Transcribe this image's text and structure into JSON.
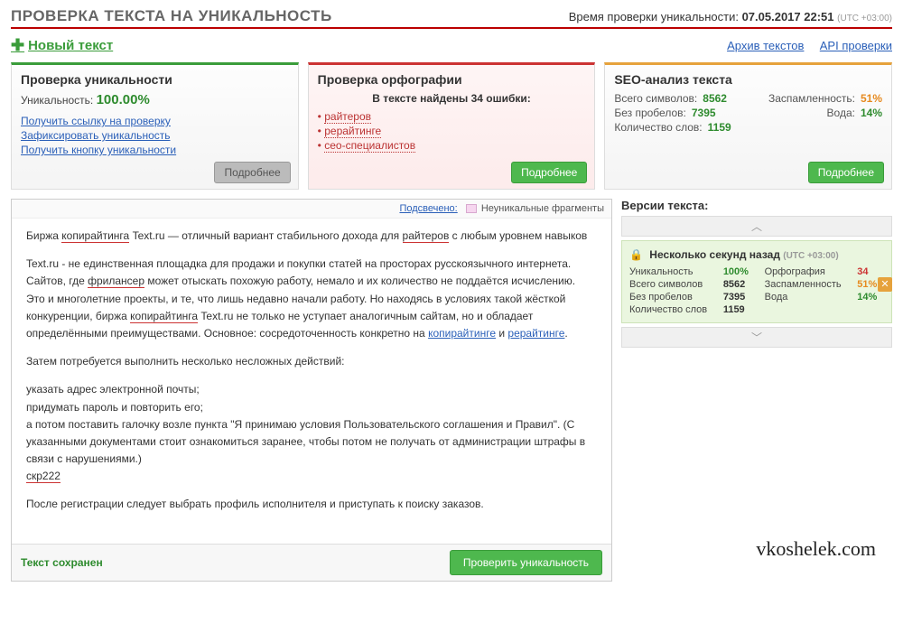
{
  "header": {
    "title": "ПРОВЕРКА ТЕКСТА НА УНИКАЛЬНОСТЬ",
    "time_label": "Время проверки уникальности:",
    "time_value": "07.05.2017 22:51",
    "tz": "(UTC +03:00)"
  },
  "subheader": {
    "new_text": "Новый текст",
    "archive": "Архив текстов",
    "api": "API проверки"
  },
  "uniq_panel": {
    "title": "Проверка уникальности",
    "label": "Уникальность:",
    "value": "100.00%",
    "link1": "Получить ссылку на проверку",
    "link2": "Зафиксировать уникальность",
    "link3": "Получить кнопку уникальности",
    "more": "Подробнее"
  },
  "spell_panel": {
    "title": "Проверка орфографии",
    "found": "В тексте найдены 34 ошибки:",
    "e1": "райтеров",
    "e2": "рерайтинге",
    "e3": "сео-специалистов",
    "more": "Подробнее"
  },
  "seo_panel": {
    "title": "SEO-анализ текста",
    "sym_label": "Всего символов:",
    "sym_val": "8562",
    "spam_label": "Заспамленность:",
    "spam_val": "51%",
    "nosp_label": "Без пробелов:",
    "nosp_val": "7395",
    "water_label": "Вода:",
    "water_val": "14%",
    "words_label": "Количество слов:",
    "words_val": "1159",
    "more": "Подробнее"
  },
  "legend": {
    "highlighted": "Подсвечено:",
    "nonunique": "Неуникальные фрагменты"
  },
  "text": {
    "p1a": "Биржа ",
    "p1b": "копирайтинга",
    "p1c": " Text.ru — отличный вариант стабильного дохода для ",
    "p1d": "райтеров",
    "p1e": " с любым уровнем навыков",
    "p2a": "Text.ru - не единственная площадка для продажи и покупки статей на просторах русскоязычного интернета. Сайтов, где ",
    "p2b": "фрилансер",
    "p2c": " может отыскать похожую работу, немало и их количество не поддаётся исчислению. Это и многолетние проекты, и те, что лишь недавно начали работу. Но находясь в условиях такой жёсткой конкуренции, биржа ",
    "p2d": "копирайтинга",
    "p2e": " Text.ru не только не уступает аналогичным сайтам, но и обладает определёнными преимуществами. Основное: сосредоточенность конкретно на ",
    "p2f": "копирайтинге",
    "p2g": " и ",
    "p2h": "рерайтинге",
    "p2i": ".",
    "p3": "Затем потребуется выполнить несколько несложных действий:",
    "p4": "указать адрес электронной почты;",
    "p5": "придумать пароль и повторить его;",
    "p6": "а потом поставить галочку возле пункта \"Я принимаю условия Пользовательского соглашения и Правил\". (С указанными документами стоит ознакомиться заранее, чтобы потом не получать от администрации штрафы в связи с нарушениями.)",
    "p7": "скр222",
    "p8": "После регистрации следует выбрать профиль исполнителя и приступать к поиску заказов."
  },
  "footer": {
    "saved": "Текст сохранен",
    "check": "Проверить уникальность"
  },
  "versions": {
    "title": "Версии текста:",
    "head": "Несколько секунд назад",
    "tz": "(UTC +03:00)",
    "uniq_l": "Уникальность",
    "uniq_v": "100%",
    "orth_l": "Орфография",
    "orth_v": "34",
    "sym_l": "Всего символов",
    "sym_v": "8562",
    "spam_l": "Заспамленность",
    "spam_v": "51%",
    "nosp_l": "Без пробелов",
    "nosp_v": "7395",
    "water_l": "Вода",
    "water_v": "14%",
    "words_l": "Количество слов",
    "words_v": "1159"
  },
  "watermark": "vkoshelek.com"
}
